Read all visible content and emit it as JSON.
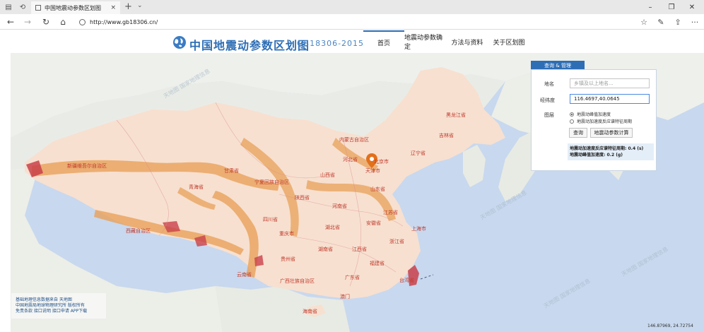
{
  "browser": {
    "tab_title": "中国地震动参数区划图",
    "tab_close": "×",
    "new_tab": "+",
    "tab_menu": "⌄",
    "url": "http://www.gb18306.cn/",
    "minimize": "–",
    "restore": "❐",
    "close": "✕",
    "back": "←",
    "forward": "→",
    "refresh": "↻",
    "home": "⌂",
    "favorites": "☆",
    "reading": "✎",
    "share": "⇪",
    "more": "···"
  },
  "site": {
    "title": "中国地震动参数区划图",
    "code": "GB18306-2015",
    "nav": [
      {
        "label": "首页",
        "active": true
      },
      {
        "label": "地震动参数确定",
        "active": false
      },
      {
        "label": "方法与资料",
        "active": false
      },
      {
        "label": "关于区划图",
        "active": false
      }
    ]
  },
  "panel": {
    "tab_label": "查询 & 管理",
    "place_label": "地名",
    "place_placeholder": "乡镇及以上地名...",
    "coord_label": "经纬度",
    "coord_value": "116.4697,40.0645",
    "layer_label": "图层",
    "layer_options": [
      "地震动峰值加速度",
      "地震动加速度反应谱特征周期"
    ],
    "query_button": "查询",
    "calc_button": "地震动参数计算",
    "result_line1": "地震动加速度反应谱特征周期: 0.4 (s)",
    "result_line2": "地震动峰值加速度: 0.2 (g)"
  },
  "map": {
    "labels": [
      {
        "text": "黑龙江省"
      },
      {
        "text": "吉林省"
      },
      {
        "text": "辽宁省"
      },
      {
        "text": "内蒙古自治区"
      },
      {
        "text": "北京市"
      },
      {
        "text": "天津市"
      },
      {
        "text": "河北省"
      },
      {
        "text": "山西省"
      },
      {
        "text": "山东省"
      },
      {
        "text": "新疆维吾尔自治区"
      },
      {
        "text": "甘肃省"
      },
      {
        "text": "宁夏回族自治区"
      },
      {
        "text": "青海省"
      },
      {
        "text": "陕西省"
      },
      {
        "text": "河南省"
      },
      {
        "text": "江苏省"
      },
      {
        "text": "上海市"
      },
      {
        "text": "安徽省"
      },
      {
        "text": "湖北省"
      },
      {
        "text": "四川省"
      },
      {
        "text": "重庆市"
      },
      {
        "text": "西藏自治区"
      },
      {
        "text": "浙江省"
      },
      {
        "text": "湖南省"
      },
      {
        "text": "江西省"
      },
      {
        "text": "贵州省"
      },
      {
        "text": "福建省"
      },
      {
        "text": "台湾省"
      },
      {
        "text": "云南省"
      },
      {
        "text": "广西壮族自治区"
      },
      {
        "text": "广东省"
      },
      {
        "text": "澳门"
      },
      {
        "text": "海南省"
      }
    ],
    "watermark": "天地图 国家地理信息",
    "credit_lines": [
      "基础地理信息数据来自 天地图",
      "中国地震局地球物理研究所 版权所有",
      "免责条款 接口说明 接口申请 APP下载"
    ],
    "coords_readout": "146.87969, 24.72754"
  },
  "colors": {
    "brand": "#2e6eb5",
    "ocean": "#c8d8ee",
    "hazard_low": "#f6cfb8",
    "hazard_mid": "#e8a15a",
    "hazard_high": "#c9414a"
  }
}
